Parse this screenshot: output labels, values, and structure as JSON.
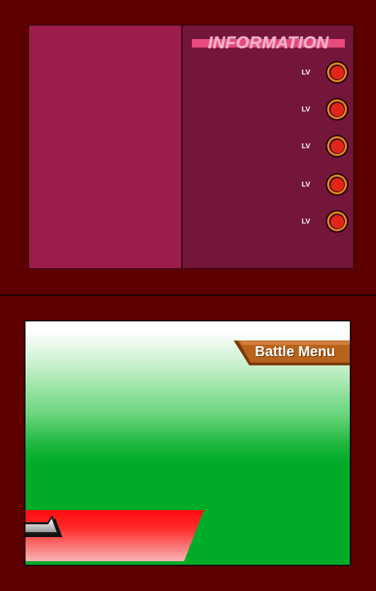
{
  "info_panel": {
    "title": "INFORMATION",
    "party": [
      {
        "lv_label": "LV",
        "icon": "pokeball-icon"
      },
      {
        "lv_label": "LV",
        "icon": "pokeball-icon"
      },
      {
        "lv_label": "LV",
        "icon": "pokeball-icon"
      },
      {
        "lv_label": "LV",
        "icon": "pokeball-icon"
      },
      {
        "lv_label": "LV",
        "icon": "pokeball-icon"
      }
    ]
  },
  "touch_screen": {
    "battle_menu_label": "Battle Menu",
    "back_button_icon": "back-arrow-icon"
  },
  "colors": {
    "frame": "#5c0000",
    "info_left": "#9c1c4c",
    "info_right": "#74163a",
    "info_banner": "#e84a7e",
    "tab_orange": "#b8621c",
    "field_green": "#00ab28",
    "back_red": "#ff1010"
  }
}
